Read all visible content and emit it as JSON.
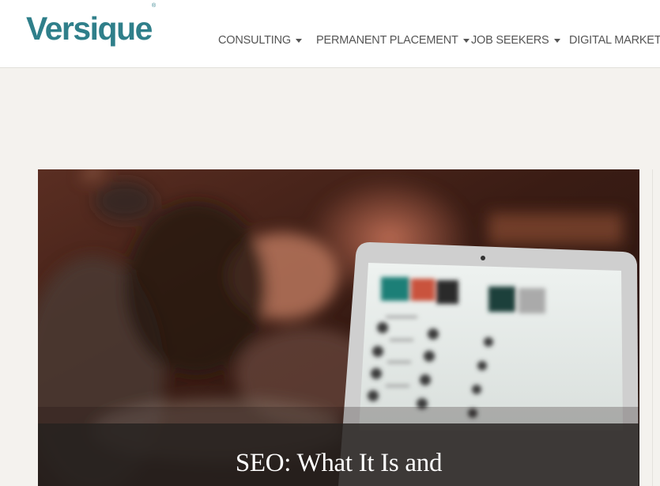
{
  "logo": {
    "text": "Versique",
    "mark": "®"
  },
  "nav": {
    "items": [
      {
        "label": "CONSULTING"
      },
      {
        "label": "PERMANENT PLACEMENT"
      },
      {
        "label": "JOB SEEKERS"
      },
      {
        "label": "DIGITAL MARKETING"
      }
    ]
  },
  "article": {
    "title": "SEO: What It Is and"
  },
  "colors": {
    "brand": "#2f7f8a",
    "nav_text": "#555555",
    "page_bg": "#f4f2ee"
  }
}
